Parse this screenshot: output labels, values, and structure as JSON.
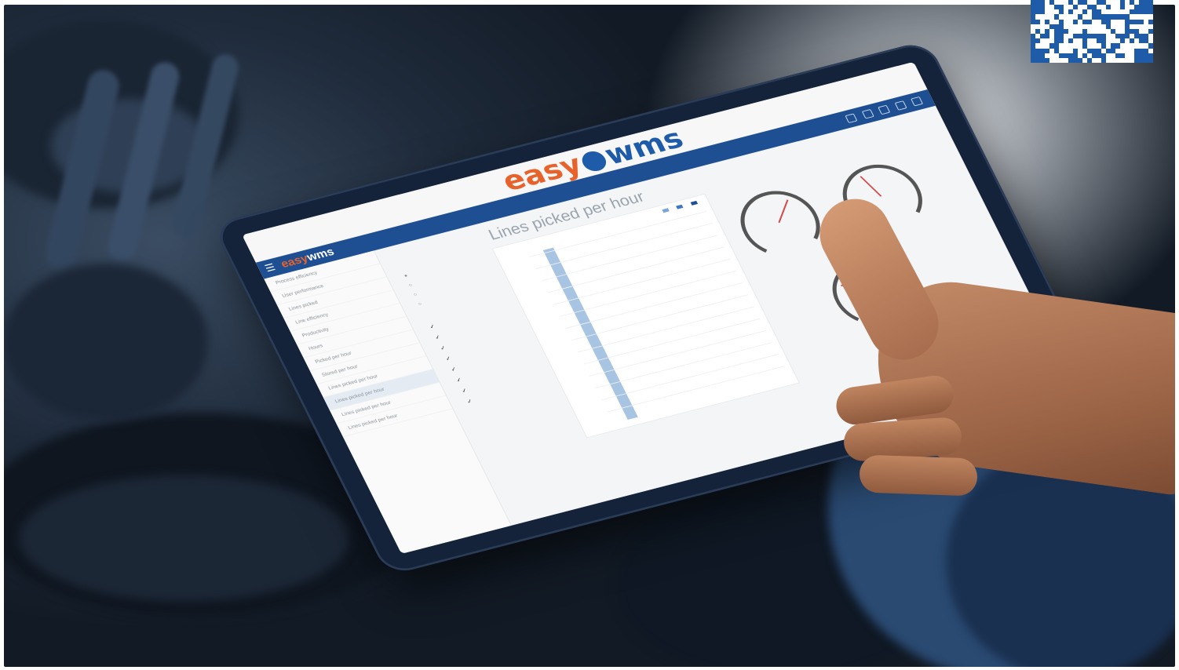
{
  "screen": {
    "brand": {
      "part1": "easy",
      "part2": "wms"
    },
    "page_title": "Lines picked per hour",
    "sidebar": {
      "items": [
        "Process efficiency",
        "User performance",
        "Lines picked",
        "Line efficiency",
        "Productivity",
        "Hours",
        "Picked per hour",
        "Stored per hour",
        "Lines picked per hour",
        "Lines picked per hour",
        "Lines picked per hour",
        "Lines picked per hour"
      ],
      "active_index": 9
    },
    "chart": {
      "type": "bar",
      "series_colors": [
        "#a7c4e3"
      ]
    },
    "colors": {
      "accent": "#1f4f93",
      "brand_orange": "#e8632b",
      "brand_blue": "#1e5ba8"
    }
  },
  "scene": {
    "qr_code": "qr-code-icon"
  }
}
